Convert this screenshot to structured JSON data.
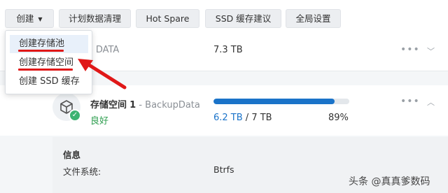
{
  "toolbar": {
    "create_label": "创建",
    "buttons": [
      "计划数据清理",
      "Hot Spare",
      "SSD 缓存建议",
      "全局设置"
    ]
  },
  "dropdown": {
    "items": [
      "创建存储池",
      "创建存储空间",
      "创建 SSD 缓存"
    ]
  },
  "pool": {
    "name": "- DATA",
    "size": "7.3 TB"
  },
  "volume": {
    "title": "存储空间",
    "number": "1",
    "separator": " - ",
    "pool_name": "BackupData",
    "status": "良好",
    "used": "6.2 TB",
    "total_sep": " / ",
    "total": "7 TB",
    "percent": "89%",
    "usage_fraction": 0.89
  },
  "info": {
    "title": "信息",
    "filesystem_label": "文件系统:",
    "filesystem_value": "Btrfs"
  },
  "watermark": "头条 @真真爹数码",
  "icons": {
    "more": "more-icon",
    "chevron_down": "chevron-down-icon",
    "chevron_up": "chevron-up-icon",
    "volume": "volume-cube-icon",
    "status_ok": "check-icon"
  },
  "colors": {
    "accent": "#1a73c9",
    "status_ok": "#2e9e4f",
    "annotation": "#e01818"
  }
}
